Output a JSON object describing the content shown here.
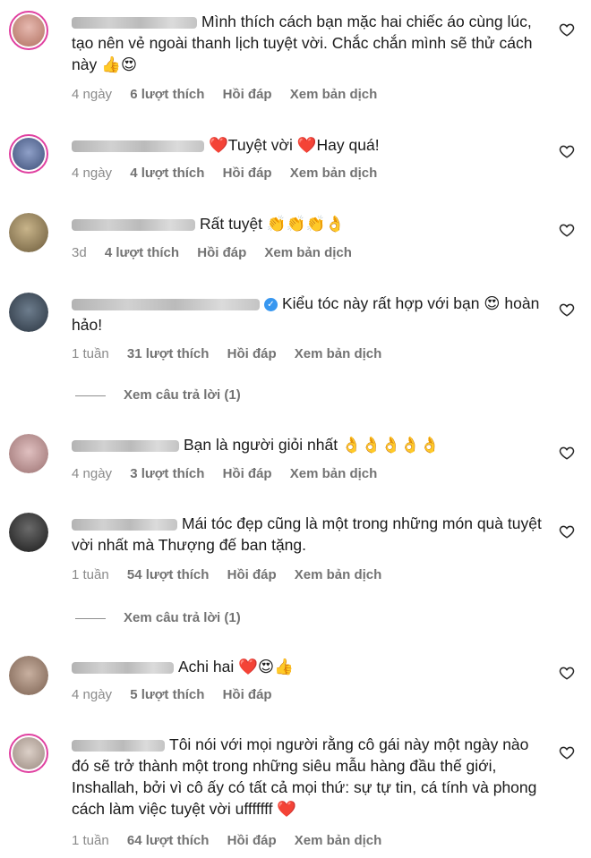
{
  "comments": [
    {
      "text": "Mình thích cách bạn mặc hai chiếc áo cùng lúc, tạo nên vẻ ngoài thanh lịch tuyệt vời. Chắc chắn mình sẽ thử cách này 👍😍",
      "time": "4 ngày",
      "likes": "6 lượt thích",
      "reply": "Hồi đáp",
      "translate": "Xem bản dịch",
      "avatar_color": "#d9a0a0"
    },
    {
      "text": "❤️Tuyệt vời ❤️Hay quá!",
      "time": "4 ngày",
      "likes": "4 lượt thích",
      "reply": "Hồi đáp",
      "translate": "Xem bản dịch",
      "avatar_color": "#6a7fa8"
    },
    {
      "text": "Rất tuyệt 👏👏👏👌",
      "time": "3d",
      "likes": "4 lượt thích",
      "reply": "Hồi đáp",
      "translate": "Xem bản dịch",
      "avatar_color": "#8a7a5a"
    },
    {
      "text": "Kiểu tóc này rất hợp với bạn 😍 hoàn hảo!",
      "time": "1 tuần",
      "likes": "31 lượt thích",
      "reply": "Hồi đáp",
      "translate": "Xem bản dịch",
      "avatar_color": "#4a5a6a"
    },
    {
      "text": "Bạn là người giỏi nhất 👌👌👌👌👌",
      "time": "4 ngày",
      "likes": "3 lượt thích",
      "reply": "Hồi đáp",
      "translate": "Xem bản dịch",
      "avatar_color": "#b89090"
    },
    {
      "text": "Mái tóc đẹp cũng là một trong những món quà tuyệt vời nhất mà Thượng đế ban tặng.",
      "time": "1 tuần",
      "likes": "54 lượt thích",
      "reply": "Hồi đáp",
      "translate": "Xem bản dịch",
      "avatar_color": "#3a3a3a"
    },
    {
      "text": "Achi hai ❤️😍👍",
      "time": "4 ngày",
      "likes": "5 lượt thích",
      "reply": "Hồi đáp",
      "translate": "",
      "avatar_color": "#a08a7a"
    },
    {
      "text": "Tôi nói với mọi người rằng cô gái này một ngày nào đó sẽ trở thành một trong những siêu mẫu hàng đầu thế giới, Inshallah, bởi vì cô ấy có tất cả mọi thứ: sự tự tin, cá tính và phong cách làm việc tuyệt vời ufffffff ❤️",
      "time": "1 tuần",
      "likes": "64 lượt thích",
      "reply": "Hồi đáp",
      "translate": "Xem bản dịch",
      "avatar_color": "#c0b0a8"
    }
  ],
  "view_replies": [
    "Xem câu trả lời (1)",
    "Xem câu trả lời (1)"
  ]
}
